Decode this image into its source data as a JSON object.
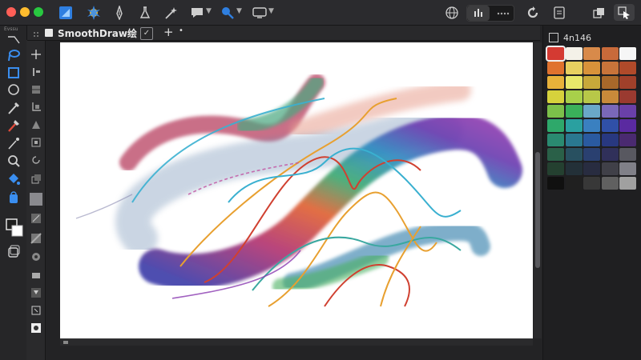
{
  "app": {
    "tab_title": "SmoothDraw绘",
    "tab_badge": "✓",
    "tab_add": "+",
    "tab_more": "•",
    "left_panel_label": "Evssu"
  },
  "color_panel": {
    "title": "4n146",
    "swatches": [
      "#d43a32",
      "#f4f1e8",
      "#d88a4a",
      "#c86a3a",
      "#f6f6f6",
      "#e0722e",
      "#e8d060",
      "#d8923a",
      "#c8743a",
      "#b04a2a",
      "#e8b23a",
      "#e8e86a",
      "#c8a83a",
      "#a8682a",
      "#a0402a",
      "#d6d23c",
      "#a8d04a",
      "#b8c848",
      "#c88a3a",
      "#9a3a30",
      "#7cc04a",
      "#3ab05a",
      "#6aa8c8",
      "#7a68b8",
      "#6a40a8",
      "#2ea86a",
      "#2aa0a0",
      "#3a80c0",
      "#3050a8",
      "#5a2aa0",
      "#2a8a70",
      "#2a7890",
      "#2a5aa0",
      "#283880",
      "#4a2a70",
      "#2a6048",
      "#285060",
      "#2a4070",
      "#30305a",
      "#585860",
      "#244030",
      "#233038",
      "#282c40",
      "#404048",
      "#808088",
      "#101010",
      "#202020",
      "#383838",
      "#606060",
      "#a0a0a0"
    ]
  }
}
